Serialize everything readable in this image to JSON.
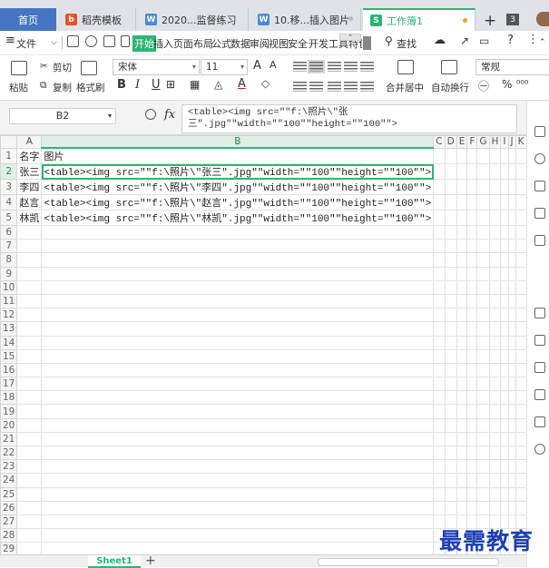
{
  "tabs": [
    {
      "label": "首页",
      "type": "home"
    },
    {
      "label": "稻壳模板",
      "type": "docer"
    },
    {
      "label": "2020...监督练习",
      "type": "word"
    },
    {
      "label": "10.移...插入图片",
      "type": "word"
    },
    {
      "label": "工作簿1",
      "type": "sheet",
      "active": true
    }
  ],
  "tab_count": "3",
  "menu": {
    "file": "文件",
    "items": [
      "开始",
      "插入",
      "页面布局",
      "公式",
      "数据",
      "审阅",
      "视图",
      "安全",
      "开发工具",
      "特色"
    ],
    "active": "开始",
    "search": "查找"
  },
  "ribbon": {
    "paste": "粘贴",
    "cut": "剪切",
    "copy": "复制",
    "format_painter": "格式刷",
    "font_name": "宋体",
    "font_size": "11",
    "bold": "B",
    "italic": "I",
    "underline": "U",
    "merge_center": "合并居中",
    "auto_wrap": "自动换行",
    "number_format": "常规"
  },
  "formula_bar": {
    "name_box": "B2",
    "fx": "fx",
    "formula": "<table><img src=\"\"f:\\照片\\\"张\n三\".jpg\"\"width=\"\"100\"\"height=\"\"100\"\">"
  },
  "grid": {
    "columns": [
      "A",
      "B",
      "C",
      "D",
      "E",
      "F",
      "G",
      "H",
      "I",
      "J",
      "K"
    ],
    "row_count": 30,
    "selected_cell": "B2",
    "rows": [
      {
        "a": "名字",
        "b": "图片"
      },
      {
        "a": "张三",
        "b": "<table><img src=\"\"f:\\照片\\\"张三\".jpg\"\"width=\"\"100\"\"height=\"\"100\"\">"
      },
      {
        "a": "李四",
        "b": "<table><img src=\"\"f:\\照片\\\"李四\".jpg\"\"width=\"\"100\"\"height=\"\"100\"\">"
      },
      {
        "a": "赵言",
        "b": "<table><img src=\"\"f:\\照片\\\"赵言\".jpg\"\"width=\"\"100\"\"height=\"\"100\"\">"
      },
      {
        "a": "林凯",
        "b": "<table><img src=\"\"f:\\照片\\\"林凯\".jpg\"\"width=\"\"100\"\"height=\"\"100\"\">"
      }
    ]
  },
  "sheets": [
    {
      "label": "Sheet1",
      "active": true
    }
  ],
  "watermark": "最需教育"
}
